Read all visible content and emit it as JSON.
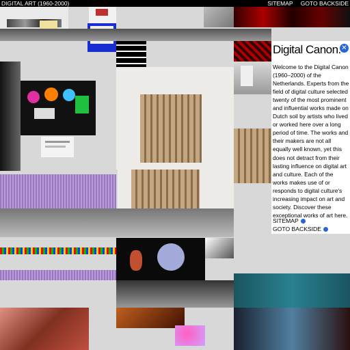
{
  "header": {
    "site_title": "DIGITAL ART (1960-2000)",
    "nav": [
      {
        "label": "SITEMAP"
      },
      {
        "label": "GOTO BACKSIDE"
      }
    ]
  },
  "panel": {
    "title": "Digital Canon.",
    "body": "Welcome to the Digital Canon (1960–2000) of the Netherlands. Experts from the field of digital culture selected twenty of the most prominent and influential works made on Dutch soil by artists who lived or worked here over a long period of time. The works and their makers are not all equally well known, yet this does not detract from their lasting influence on digital art and culture. Each of the works makes use of or responds to digital culture's increasing impact on art and society. Discover these exceptional works of art here.",
    "links": [
      {
        "label": "SITEMAP"
      },
      {
        "label": "GOTO BACKSIDE"
      }
    ]
  },
  "colors": {
    "accent": "#2c64d6",
    "topbar": "#000000",
    "background": "#d8d8d8"
  },
  "icons": {
    "close": "close-icon"
  }
}
